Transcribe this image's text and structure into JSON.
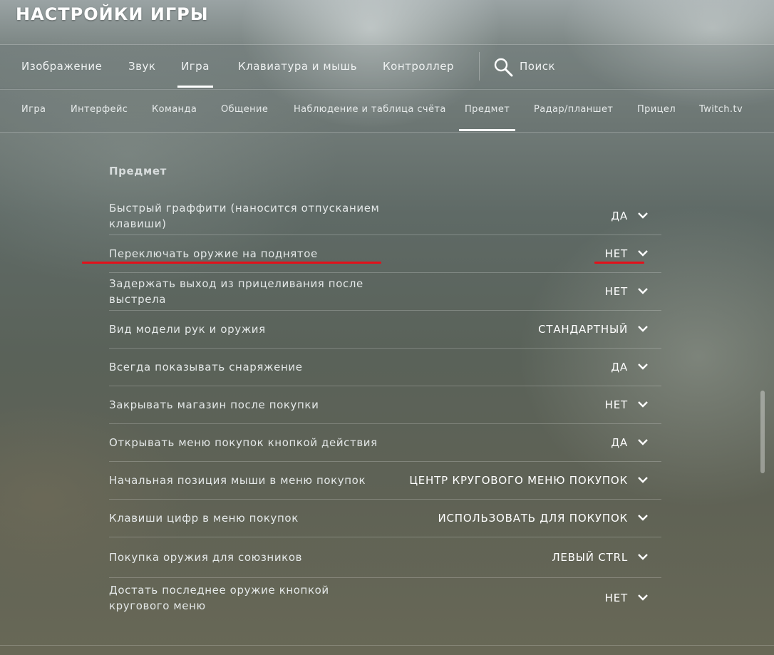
{
  "header": {
    "title": "НАСТРОЙКИ ИГРЫ"
  },
  "main_tabs": [
    {
      "label": "Изображение",
      "active": false
    },
    {
      "label": "Звук",
      "active": false
    },
    {
      "label": "Игра",
      "active": true
    },
    {
      "label": "Клавиатура и мышь",
      "active": false
    },
    {
      "label": "Контроллер",
      "active": false
    }
  ],
  "search": {
    "label": "Поиск",
    "icon": "search-icon"
  },
  "sub_tabs": [
    {
      "label": "Игра",
      "active": false
    },
    {
      "label": "Интерфейс",
      "active": false
    },
    {
      "label": "Команда",
      "active": false
    },
    {
      "label": "Общение",
      "active": false
    },
    {
      "label": "Наблюдение и таблица счёта",
      "active": false
    },
    {
      "label": "Предмет",
      "active": true
    },
    {
      "label": "Радар/планшет",
      "active": false
    },
    {
      "label": "Прицел",
      "active": false
    },
    {
      "label": "Twitch.tv",
      "active": false
    }
  ],
  "section": {
    "title": "Предмет"
  },
  "settings": [
    {
      "label": "Быстрый граффити (наносится отпусканием клавиши)",
      "value": "ДА"
    },
    {
      "label": "Переключать оружие на поднятое",
      "value": "НЕТ",
      "highlighted": true
    },
    {
      "label": "Задержать выход из прицеливания после выстрела",
      "value": "НЕТ"
    },
    {
      "label": "Вид модели рук и оружия",
      "value": "СТАНДАРТНЫЙ"
    },
    {
      "label": "Всегда показывать снаряжение",
      "value": "ДА"
    },
    {
      "label": "Закрывать магазин после покупки",
      "value": "НЕТ"
    },
    {
      "label": "Открывать меню покупок кнопкой действия",
      "value": "ДА"
    },
    {
      "label": "Начальная позиция мыши в меню покупок",
      "value": "ЦЕНТР КРУГОВОГО МЕНЮ ПОКУПОК"
    },
    {
      "label": "Клавиши цифр в меню покупок",
      "value": "ИСПОЛЬЗОВАТЬ ДЛЯ ПОКУПОК"
    },
    {
      "label": "Покупка оружия для союзников",
      "value": "ЛЕВЫЙ CTRL"
    },
    {
      "label": "Достать последнее оружие кнопкой кругового меню",
      "value": "НЕТ"
    }
  ],
  "colors": {
    "accent": "#ffffff",
    "annotation": "#e3101a"
  }
}
